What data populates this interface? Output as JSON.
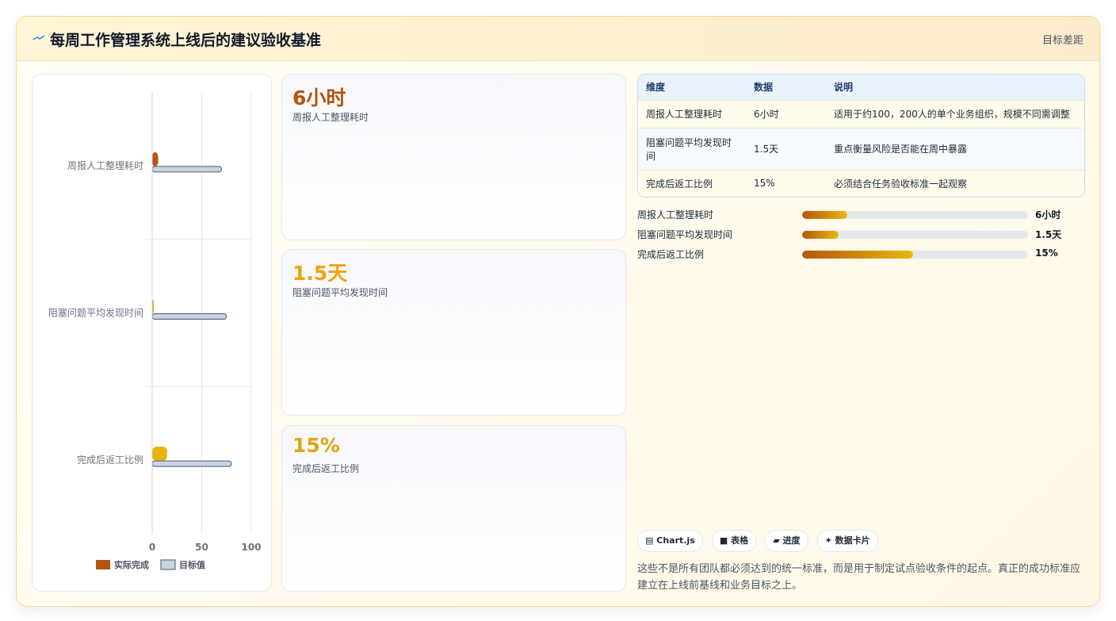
{
  "header": {
    "icon": "activity-icon",
    "title": "每周工作管理系统上线后的建议验收基准",
    "link": "目标差距"
  },
  "chart_data": {
    "type": "bar",
    "orientation": "horizontal",
    "categories": [
      "周报人工整理耗时",
      "阻塞问题平均发现时间",
      "完成后返工比例"
    ],
    "series": [
      {
        "name": "实际完成",
        "values": [
          6,
          1.5,
          15
        ],
        "colors": [
          "#b4540e",
          "#f0a20a",
          "#e8b30c"
        ]
      },
      {
        "name": "目标值",
        "values": [
          70,
          75,
          80
        ],
        "color": "#c8d4e3"
      }
    ],
    "xlim": [
      0,
      100
    ],
    "xticks": [
      "0",
      "50",
      "100"
    ],
    "legend_position": "bottom",
    "grid": true
  },
  "cards": [
    {
      "value": "6小时",
      "label": "周报人工整理耗时",
      "color": "#b4540e"
    },
    {
      "value": "1.5天",
      "label": "阻塞问题平均发现时间",
      "color": "#f0a20a"
    },
    {
      "value": "15%",
      "label": "完成后返工比例",
      "color": "#e0a50c"
    }
  ],
  "table": {
    "headers": [
      "维度",
      "数据",
      "说明"
    ],
    "rows": [
      [
        "周报人工整理耗时",
        "6小时",
        "适用于约100，200人的单个业务组织，规模不同需调整"
      ],
      [
        "阻塞问题平均发现时间",
        "1.5天",
        "重点衡量风险是否能在周中暴露"
      ],
      [
        "完成后返工比例",
        "15%",
        "必须结合任务验收标准一起观察"
      ]
    ]
  },
  "progress": [
    {
      "label": "周报人工整理耗时",
      "value": "6小时",
      "fraction": 0.2
    },
    {
      "label": "阻塞问题平均发现时间",
      "value": "1.5天",
      "fraction": 0.16
    },
    {
      "label": "完成后返工比例",
      "value": "15%",
      "fraction": 0.49
    }
  ],
  "chips": [
    {
      "icon": "chart-icon",
      "glyph": "▤",
      "label": "Chart.js"
    },
    {
      "icon": "table-icon",
      "glyph": "■",
      "label": "表格"
    },
    {
      "icon": "progress-icon",
      "glyph": "▰",
      "label": "进度"
    },
    {
      "icon": "sparkle-icon",
      "glyph": "✦",
      "label": "数据卡片"
    }
  ],
  "note": "这些不是所有团队都必须达到的统一标准，而是用于制定试点验收条件的起点。真正的成功标准应建立在上线前基线和业务目标之上。"
}
